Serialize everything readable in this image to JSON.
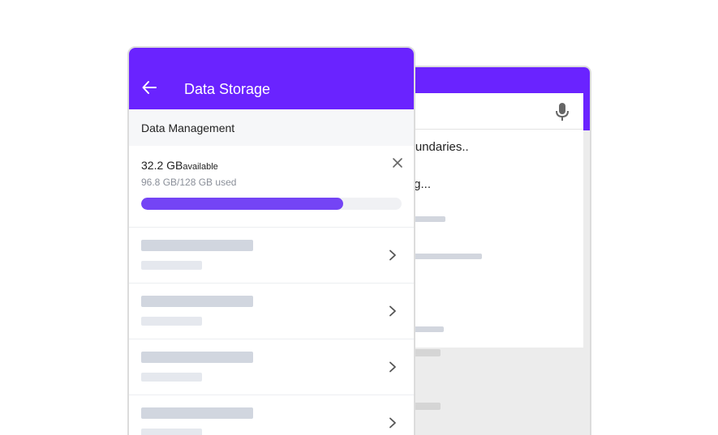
{
  "search_screen": {
    "suggestions": [
      "r boundaries..",
      "rying..."
    ]
  },
  "storage_screen": {
    "title": "Data Storage",
    "section": "Data Management",
    "storage": {
      "available_value": "32.2 GB",
      "available_label": "available",
      "used_text": "96.8 GB/128 GB used",
      "used_fraction": 0.776
    },
    "colors": {
      "header": "#6a23ff",
      "progress": "#7444f5"
    },
    "rows": [
      {
        "icon": "chevron-right-icon"
      },
      {
        "icon": "chevron-right-icon"
      },
      {
        "icon": "chevron-right-icon"
      },
      {
        "icon": "chevron-right-icon"
      }
    ]
  }
}
